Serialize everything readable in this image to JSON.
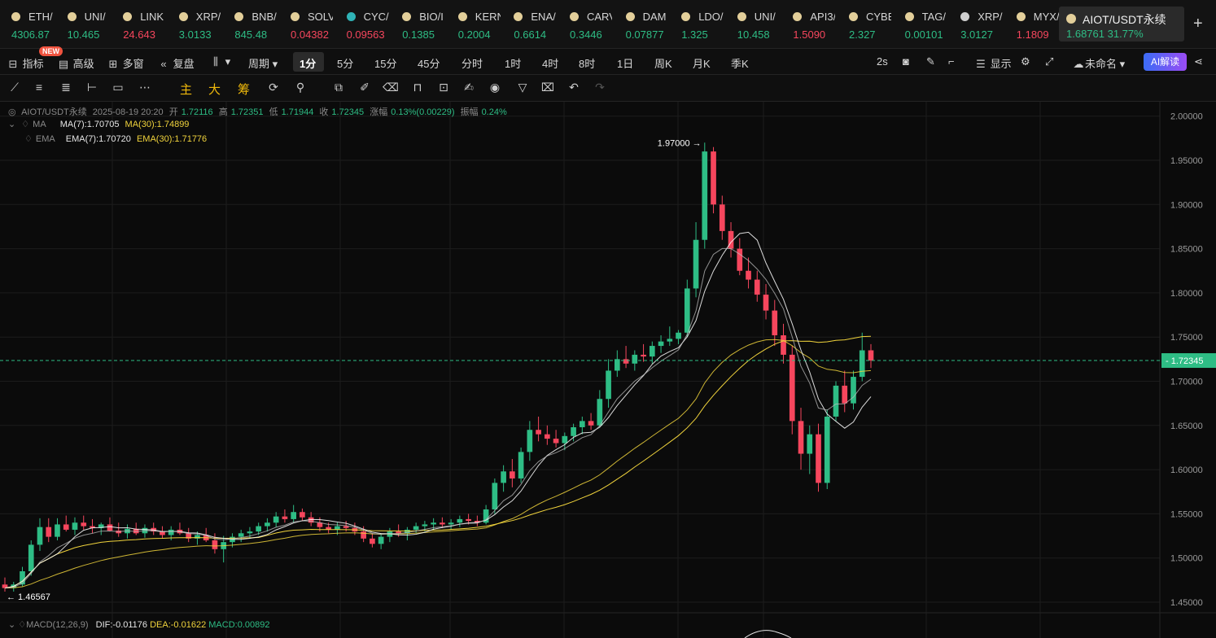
{
  "ticker": [
    {
      "symbol": "ETH/",
      "price": "4306.87",
      "dir": "up",
      "coin_color": "#e3cf9a"
    },
    {
      "symbol": "UNI/",
      "price": "10.465",
      "dir": "up",
      "coin_color": "#e3cf9a"
    },
    {
      "symbol": "LINK",
      "price": "24.643",
      "dir": "down",
      "coin_color": "#e3cf9a"
    },
    {
      "symbol": "XRP/",
      "price": "3.0133",
      "dir": "up",
      "coin_color": "#e3cf9a"
    },
    {
      "symbol": "BNB/",
      "price": "845.48",
      "dir": "up",
      "coin_color": "#e3cf9a"
    },
    {
      "symbol": "SOLV",
      "price": "0.04382",
      "dir": "down",
      "coin_color": "#e3cf9a"
    },
    {
      "symbol": "CYC/",
      "price": "0.09563",
      "dir": "down",
      "coin_color": "#2fb3b6"
    },
    {
      "symbol": "BIO/I",
      "price": "0.1385",
      "dir": "up",
      "coin_color": "#e3cf9a"
    },
    {
      "symbol": "KERN",
      "price": "0.2004",
      "dir": "up",
      "coin_color": "#e3cf9a"
    },
    {
      "symbol": "ENA/",
      "price": "0.6614",
      "dir": "up",
      "coin_color": "#e3cf9a"
    },
    {
      "symbol": "CARV",
      "price": "0.3446",
      "dir": "up",
      "coin_color": "#e3cf9a"
    },
    {
      "symbol": "DAM",
      "price": "0.07877",
      "dir": "up",
      "coin_color": "#e3cf9a"
    },
    {
      "symbol": "LDO/",
      "price": "1.325",
      "dir": "up",
      "coin_color": "#e3cf9a"
    },
    {
      "symbol": "UNI/",
      "price": "10.458",
      "dir": "up",
      "coin_color": "#e3cf9a"
    },
    {
      "symbol": "API3/",
      "price": "1.5090",
      "dir": "down",
      "coin_color": "#e3cf9a"
    },
    {
      "symbol": "CYBE",
      "price": "2.327",
      "dir": "up",
      "coin_color": "#e3cf9a"
    },
    {
      "symbol": "TAG/",
      "price": "0.00101",
      "dir": "up",
      "coin_color": "#e3cf9a"
    },
    {
      "symbol": "XRP/",
      "price": "3.0127",
      "dir": "up",
      "coin_color": "#cfcfcf"
    },
    {
      "symbol": "MYX/",
      "price": "1.1809",
      "dir": "down",
      "coin_color": "#e3cf9a"
    }
  ],
  "active_ticker": {
    "symbol": "AIOT/USDT永续",
    "price": "1.68761",
    "change": "31.77%",
    "coin_color": "#e3cf9a"
  },
  "toolbar": {
    "indicator": "指标",
    "new_badge": "NEW",
    "advanced": "高级",
    "multi_window": "多窗",
    "replay": "复盘",
    "period": "周期",
    "intervals": [
      "1分",
      "5分",
      "15分",
      "45分",
      "分时",
      "1时",
      "4时",
      "8时",
      "1日",
      "周K",
      "月K",
      "季K"
    ],
    "selected_interval": "1分",
    "refresh": "2s",
    "display": "显示",
    "layout_name": "未命名",
    "ai_button": "AI解读"
  },
  "draw_tools": {
    "main": "主",
    "big": "大",
    "chips": "筹"
  },
  "legend": {
    "pair": "AIOT/USDT永续",
    "time": "2025-08-19 20:20",
    "open_label": "开",
    "open": "1.72116",
    "high_label": "高",
    "high": "1.72351",
    "low_label": "低",
    "low": "1.71944",
    "close_label": "收",
    "close": "1.72345",
    "change_label": "涨幅",
    "change": "0.13%(0.00229)",
    "amp_label": "振幅",
    "amp": "0.24%",
    "ma_name": "MA",
    "ma7": "MA(7):1.70705",
    "ma30": "MA(30):1.74899",
    "ema_name": "EMA",
    "ema7": "EMA(7):1.70720",
    "ema30": "EMA(30):1.71776"
  },
  "macd": {
    "name": "MACD(12,26,9)",
    "dif": "DIF:-0.01176",
    "dea": "DEA:-0.01622",
    "macd": "MACD:0.00892"
  },
  "colors": {
    "up": "#2ebd85",
    "down": "#f6465d",
    "ma7": "#ffffff",
    "ma30": "#f0d33c",
    "grid": "#1c1c1c",
    "last_price_line": "#2ebd85"
  },
  "chart_data": {
    "type": "candlestick",
    "yticks": [
      "2.00000",
      "1.95000",
      "1.90000",
      "1.85000",
      "1.80000",
      "1.75000",
      "1.70000",
      "1.65000",
      "1.60000",
      "1.55000",
      "1.50000",
      "1.45000"
    ],
    "ylim": [
      1.43,
      2.01
    ],
    "last_price": "1.72345",
    "max_label": "1.97000",
    "min_label": "1.46567",
    "ohlc": [
      [
        1.47,
        1.478,
        1.462,
        1.466
      ],
      [
        1.466,
        1.473,
        1.462,
        1.47
      ],
      [
        1.47,
        1.49,
        1.468,
        1.485
      ],
      [
        1.485,
        1.52,
        1.48,
        1.515
      ],
      [
        1.515,
        1.545,
        1.508,
        1.535
      ],
      [
        1.535,
        1.545,
        1.518,
        1.524
      ],
      [
        1.524,
        1.545,
        1.52,
        1.538
      ],
      [
        1.538,
        1.548,
        1.53,
        1.532
      ],
      [
        1.532,
        1.546,
        1.526,
        1.54
      ],
      [
        1.54,
        1.548,
        1.532,
        1.536
      ],
      [
        1.536,
        1.544,
        1.528,
        1.534
      ],
      [
        1.534,
        1.54,
        1.526,
        1.538
      ],
      [
        1.538,
        1.546,
        1.53,
        1.531
      ],
      [
        1.531,
        1.54,
        1.524,
        1.528
      ],
      [
        1.528,
        1.538,
        1.522,
        1.533
      ],
      [
        1.533,
        1.54,
        1.526,
        1.528
      ],
      [
        1.528,
        1.538,
        1.523,
        1.534
      ],
      [
        1.534,
        1.54,
        1.526,
        1.53
      ],
      [
        1.53,
        1.536,
        1.522,
        1.526
      ],
      [
        1.526,
        1.536,
        1.52,
        1.532
      ],
      [
        1.532,
        1.54,
        1.526,
        1.528
      ],
      [
        1.528,
        1.534,
        1.518,
        1.522
      ],
      [
        1.522,
        1.53,
        1.515,
        1.526
      ],
      [
        1.526,
        1.534,
        1.518,
        1.52
      ],
      [
        1.52,
        1.528,
        1.505,
        1.51
      ],
      [
        1.51,
        1.525,
        1.495,
        1.518
      ],
      [
        1.518,
        1.528,
        1.512,
        1.524
      ],
      [
        1.524,
        1.532,
        1.518,
        1.528
      ],
      [
        1.528,
        1.535,
        1.522,
        1.53
      ],
      [
        1.53,
        1.54,
        1.526,
        1.536
      ],
      [
        1.536,
        1.545,
        1.53,
        1.54
      ],
      [
        1.54,
        1.552,
        1.535,
        1.547
      ],
      [
        1.547,
        1.555,
        1.54,
        1.544
      ],
      [
        1.544,
        1.56,
        1.54,
        1.552
      ],
      [
        1.552,
        1.556,
        1.542,
        1.546
      ],
      [
        1.546,
        1.552,
        1.536,
        1.54
      ],
      [
        1.54,
        1.546,
        1.53,
        1.535
      ],
      [
        1.535,
        1.54,
        1.528,
        1.532
      ],
      [
        1.532,
        1.54,
        1.526,
        1.536
      ],
      [
        1.536,
        1.542,
        1.53,
        1.534
      ],
      [
        1.534,
        1.54,
        1.526,
        1.53
      ],
      [
        1.53,
        1.536,
        1.518,
        1.522
      ],
      [
        1.522,
        1.528,
        1.512,
        1.516
      ],
      [
        1.516,
        1.528,
        1.51,
        1.524
      ],
      [
        1.524,
        1.534,
        1.518,
        1.53
      ],
      [
        1.53,
        1.538,
        1.524,
        1.528
      ],
      [
        1.528,
        1.535,
        1.52,
        1.532
      ],
      [
        1.532,
        1.54,
        1.528,
        1.536
      ],
      [
        1.536,
        1.542,
        1.53,
        1.538
      ],
      [
        1.538,
        1.545,
        1.532,
        1.54
      ],
      [
        1.54,
        1.546,
        1.534,
        1.538
      ],
      [
        1.538,
        1.544,
        1.532,
        1.54
      ],
      [
        1.54,
        1.548,
        1.535,
        1.544
      ],
      [
        1.544,
        1.55,
        1.538,
        1.542
      ],
      [
        1.542,
        1.548,
        1.536,
        1.54
      ],
      [
        1.54,
        1.56,
        1.538,
        1.555
      ],
      [
        1.555,
        1.59,
        1.55,
        1.585
      ],
      [
        1.585,
        1.605,
        1.575,
        1.598
      ],
      [
        1.598,
        1.612,
        1.58,
        1.59
      ],
      [
        1.59,
        1.625,
        1.585,
        1.62
      ],
      [
        1.62,
        1.655,
        1.61,
        1.645
      ],
      [
        1.645,
        1.66,
        1.632,
        1.64
      ],
      [
        1.64,
        1.65,
        1.628,
        1.635
      ],
      [
        1.635,
        1.645,
        1.625,
        1.63
      ],
      [
        1.63,
        1.642,
        1.622,
        1.638
      ],
      [
        1.638,
        1.652,
        1.632,
        1.648
      ],
      [
        1.648,
        1.66,
        1.64,
        1.655
      ],
      [
        1.655,
        1.664,
        1.645,
        1.65
      ],
      [
        1.65,
        1.69,
        1.648,
        1.68
      ],
      [
        1.68,
        1.725,
        1.67,
        1.712
      ],
      [
        1.712,
        1.735,
        1.705,
        1.725
      ],
      [
        1.725,
        1.74,
        1.715,
        1.72
      ],
      [
        1.72,
        1.735,
        1.712,
        1.73
      ],
      [
        1.73,
        1.742,
        1.722,
        1.728
      ],
      [
        1.728,
        1.745,
        1.72,
        1.74
      ],
      [
        1.74,
        1.752,
        1.732,
        1.745
      ],
      [
        1.745,
        1.762,
        1.74,
        1.748
      ],
      [
        1.748,
        1.758,
        1.742,
        1.755
      ],
      [
        1.755,
        1.815,
        1.75,
        1.805
      ],
      [
        1.805,
        1.88,
        1.795,
        1.86
      ],
      [
        1.86,
        1.97,
        1.85,
        1.96
      ],
      [
        1.96,
        1.965,
        1.89,
        1.9
      ],
      [
        1.9,
        1.91,
        1.86,
        1.87
      ],
      [
        1.87,
        1.88,
        1.84,
        1.85
      ],
      [
        1.85,
        1.862,
        1.82,
        1.825
      ],
      [
        1.825,
        1.84,
        1.805,
        1.815
      ],
      [
        1.815,
        1.825,
        1.79,
        1.798
      ],
      [
        1.798,
        1.81,
        1.77,
        1.78
      ],
      [
        1.78,
        1.792,
        1.74,
        1.752
      ],
      [
        1.752,
        1.765,
        1.72,
        1.73
      ],
      [
        1.73,
        1.74,
        1.64,
        1.655
      ],
      [
        1.655,
        1.67,
        1.6,
        1.618
      ],
      [
        1.618,
        1.65,
        1.595,
        1.64
      ],
      [
        1.64,
        1.652,
        1.575,
        1.585
      ],
      [
        1.585,
        1.668,
        1.578,
        1.66
      ],
      [
        1.66,
        1.7,
        1.655,
        1.695
      ],
      [
        1.695,
        1.712,
        1.665,
        1.675
      ],
      [
        1.675,
        1.712,
        1.668,
        1.705
      ],
      [
        1.705,
        1.755,
        1.7,
        1.735
      ],
      [
        1.735,
        1.742,
        1.715,
        1.7234
      ]
    ]
  }
}
